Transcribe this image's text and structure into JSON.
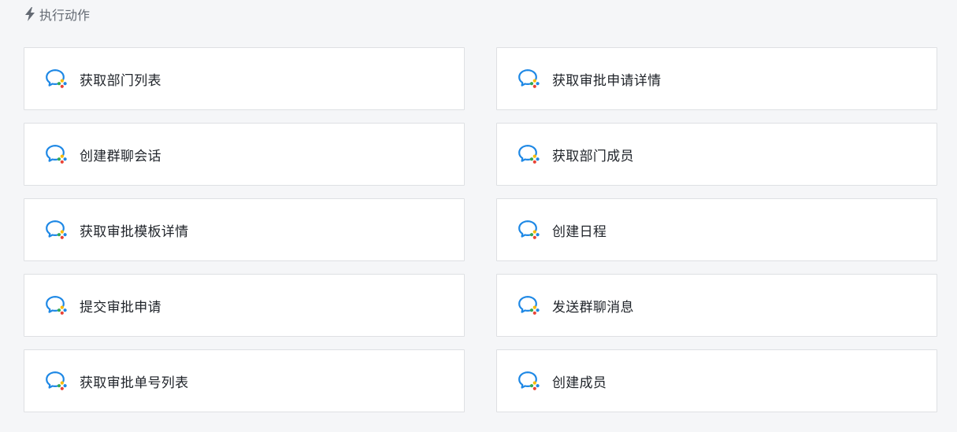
{
  "section": {
    "title": "执行动作",
    "icon": "lightning-icon"
  },
  "colors": {
    "accent_blue": "#1e88e5",
    "header_gray": "#646a73"
  },
  "actions": [
    {
      "label": "获取部门列表",
      "icon": "wecom-chat-icon"
    },
    {
      "label": "获取审批申请详情",
      "icon": "wecom-chat-icon"
    },
    {
      "label": "创建群聊会话",
      "icon": "wecom-chat-icon"
    },
    {
      "label": "获取部门成员",
      "icon": "wecom-chat-icon"
    },
    {
      "label": "获取审批模板详情",
      "icon": "wecom-chat-icon"
    },
    {
      "label": "创建日程",
      "icon": "wecom-chat-icon"
    },
    {
      "label": "提交审批申请",
      "icon": "wecom-chat-icon"
    },
    {
      "label": "发送群聊消息",
      "icon": "wecom-chat-icon"
    },
    {
      "label": "获取审批单号列表",
      "icon": "wecom-chat-icon"
    },
    {
      "label": "创建成员",
      "icon": "wecom-chat-icon"
    }
  ]
}
